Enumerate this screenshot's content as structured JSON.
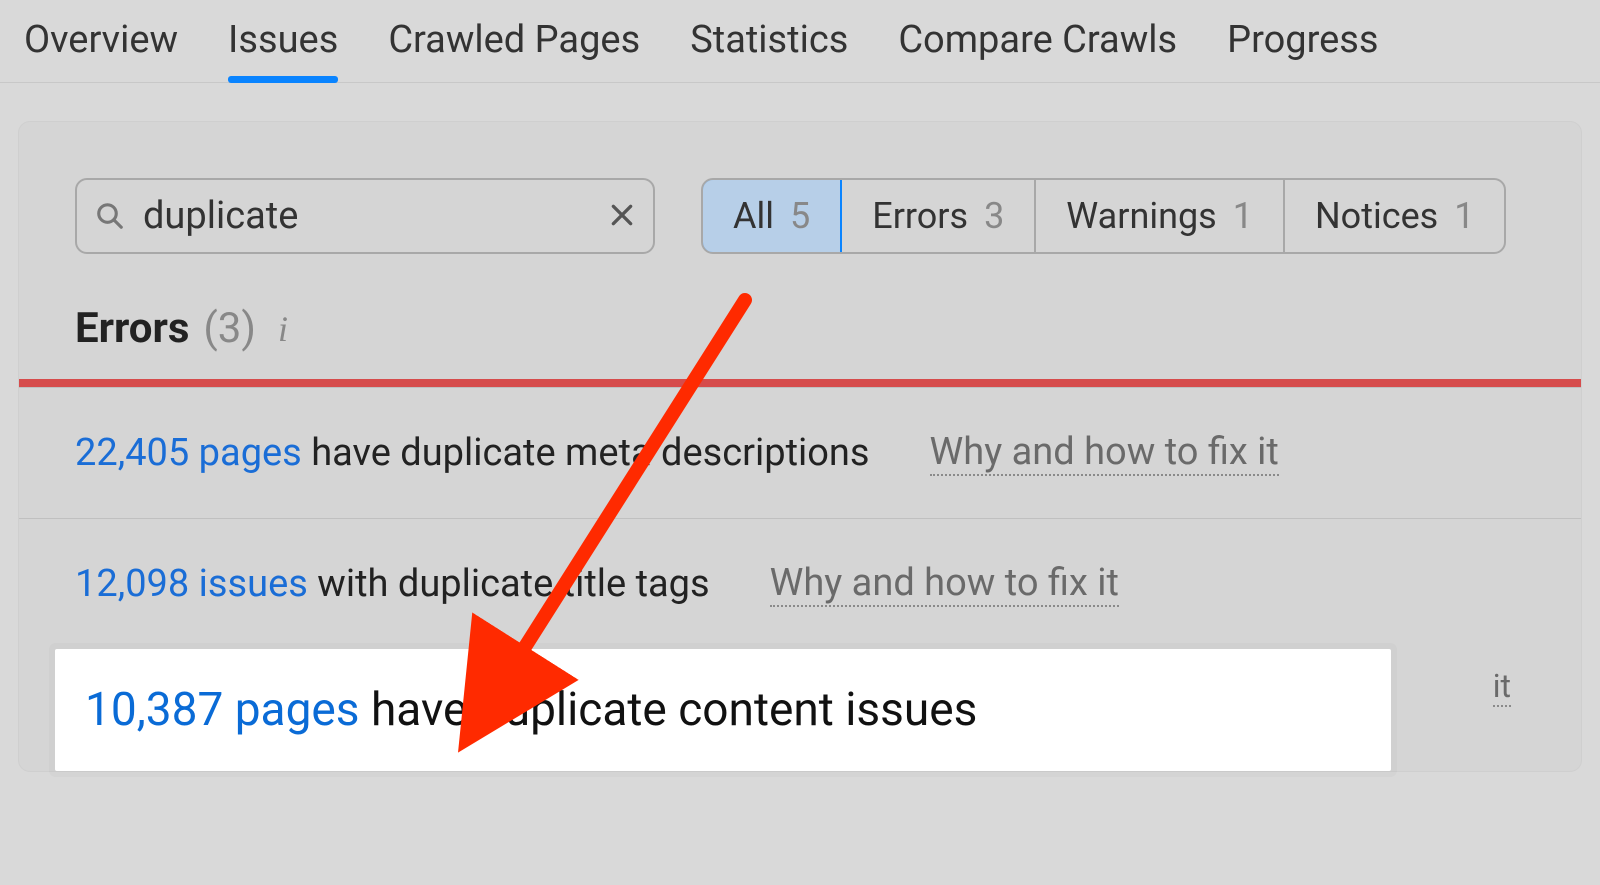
{
  "tabs": {
    "overview": "Overview",
    "issues": "Issues",
    "crawled_pages": "Crawled Pages",
    "statistics": "Statistics",
    "compare_crawls": "Compare Crawls",
    "progress": "Progress",
    "active": "issues"
  },
  "search": {
    "value": "duplicate"
  },
  "filters": {
    "all": {
      "label": "All",
      "count": "5"
    },
    "errors": {
      "label": "Errors",
      "count": "3"
    },
    "warnings": {
      "label": "Warnings",
      "count": "1"
    },
    "notices": {
      "label": "Notices",
      "count": "1"
    }
  },
  "section": {
    "title": "Errors",
    "count": "(3)"
  },
  "fix_label": "Why and how to fix it",
  "fix_tail": "it",
  "issues": [
    {
      "link_text": "22,405 pages",
      "rest": " have duplicate meta descriptions"
    },
    {
      "link_text": "12,098 issues",
      "rest": " with duplicate title tags"
    },
    {
      "link_text": "10,387 pages",
      "rest": " have duplicate content issues"
    }
  ]
}
